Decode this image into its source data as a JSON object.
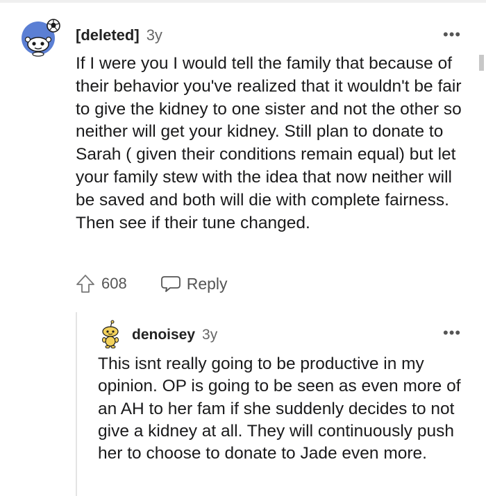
{
  "comment": {
    "author": "[deleted]",
    "age": "3y",
    "more_label": "•••",
    "avatar_icon": "reddit-snoo-deleted-avatar",
    "body": "If I were you I would tell the family that because of their behavior you've realized that it wouldn't be fair to give the kidney to one sister and not the other so neither will get your kidney. Still plan to donate to Sarah ( given their conditions remain equal) but let your family stew with the idea that now neither will be saved and both will die with complete fairness. Then see if their tune changed.",
    "vote_icon": "upvote-arrow-icon",
    "vote_count": "608",
    "reply_icon": "speech-bubble-icon",
    "reply_label": "Reply"
  },
  "reply": {
    "author": "denoisey",
    "age": "3y",
    "more_label": "•••",
    "avatar_icon": "reddit-snoo-yellow-avatar",
    "body": "This isnt really going to be productive in my opinion. OP is going to be seen as even more of an AH to her fam if she suddenly decides to not give a kidney at all. They will continuously push her to choose to donate to Jade even more."
  },
  "colors": {
    "avatar_bg": "#5b7fd4",
    "reply_avatar": "#f2d15b",
    "text": "#1a1a1b",
    "muted": "#666666",
    "thread_line": "#e4e4e4"
  }
}
